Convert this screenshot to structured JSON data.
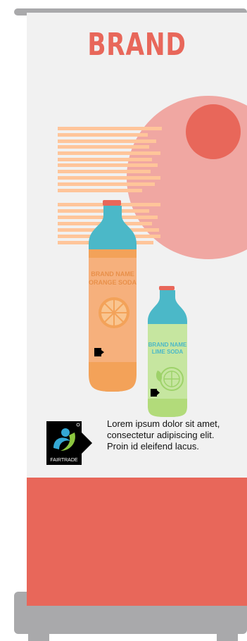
{
  "brand": {
    "title": "BRAND"
  },
  "bottles": [
    {
      "label_line1": "BRAND NAME",
      "label_line2": "ORANGE SODA"
    },
    {
      "label_line1": "BRAND NAME",
      "label_line2": "LIME SODA"
    }
  ],
  "fairtrade": {
    "label": "FAIRTRADE"
  },
  "description": "Lorem ipsum dolor sit amet, consectetur adipiscing elit. Proin id eleifend lacus.",
  "colors": {
    "accent": "#e8675a",
    "accent_light": "#f0a7a2",
    "stripe": "#ffc59a",
    "bottle_cap": "#4bb8c8",
    "orange": "#f6b07c",
    "lime": "#c6e6a0",
    "stand": "#a9a9ab"
  }
}
